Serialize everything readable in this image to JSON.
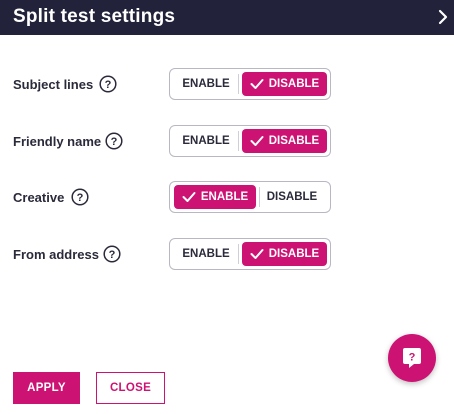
{
  "header": {
    "title": "Split test settings"
  },
  "settings": [
    {
      "label": "Subject lines",
      "enable": "ENABLE",
      "disable": "DISABLE",
      "selected": "disable"
    },
    {
      "label": "Friendly name",
      "enable": "ENABLE",
      "disable": "DISABLE",
      "selected": "disable"
    },
    {
      "label": "Creative",
      "enable": "ENABLE",
      "disable": "DISABLE",
      "selected": "enable"
    },
    {
      "label": "From address",
      "enable": "ENABLE",
      "disable": "DISABLE",
      "selected": "disable"
    }
  ],
  "footer": {
    "apply_label": "APPLY",
    "close_label": "CLOSE"
  },
  "help_fab": {
    "glyph": "?"
  },
  "icons": {
    "help": "question-circle-icon",
    "check": "check-icon",
    "header_arrow": "chevron-right-icon"
  },
  "colors": {
    "accent": "#cc1273",
    "header_bg": "#22223a"
  }
}
